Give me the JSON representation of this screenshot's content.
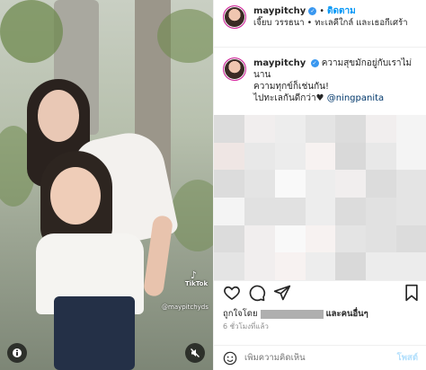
{
  "media": {
    "watermark_brand": "TikTok",
    "watermark_user": "@maypitchyds",
    "icons": [
      "tiktok-icon",
      "info-icon",
      "mute-icon"
    ]
  },
  "header": {
    "username": "maypitchy",
    "verified_badge": "✓",
    "separator": "•",
    "follow_label": "ติดตาม",
    "subtitle": "เจี๊ยบ วรรธนา • ทะเลคีใกล์ และเธอกีเศร้า"
  },
  "caption": {
    "username": "maypitchy",
    "line1": "ความสุขมักอยู่กับเราไม่นาน",
    "line2": "ความทุกข์ก็เช่นกัน!",
    "line3": "ไปทะเลกันดีกว่า♥",
    "mention": "@ningpanita"
  },
  "likes": {
    "prefix": "ถูกใจโดย",
    "suffix": "และคนอื่นๆ"
  },
  "timestamp": "6 ชั่วโมงที่แล้ว",
  "comment": {
    "placeholder": "เพิ่มความคิดเห็น",
    "post_label": "โพสต์"
  },
  "colors": {
    "link_blue": "#0095f6",
    "mention_blue": "#00376b",
    "verified_blue": "#3897f0",
    "post_disabled": "#b2dffc",
    "muted_text": "#8e8e8e"
  }
}
